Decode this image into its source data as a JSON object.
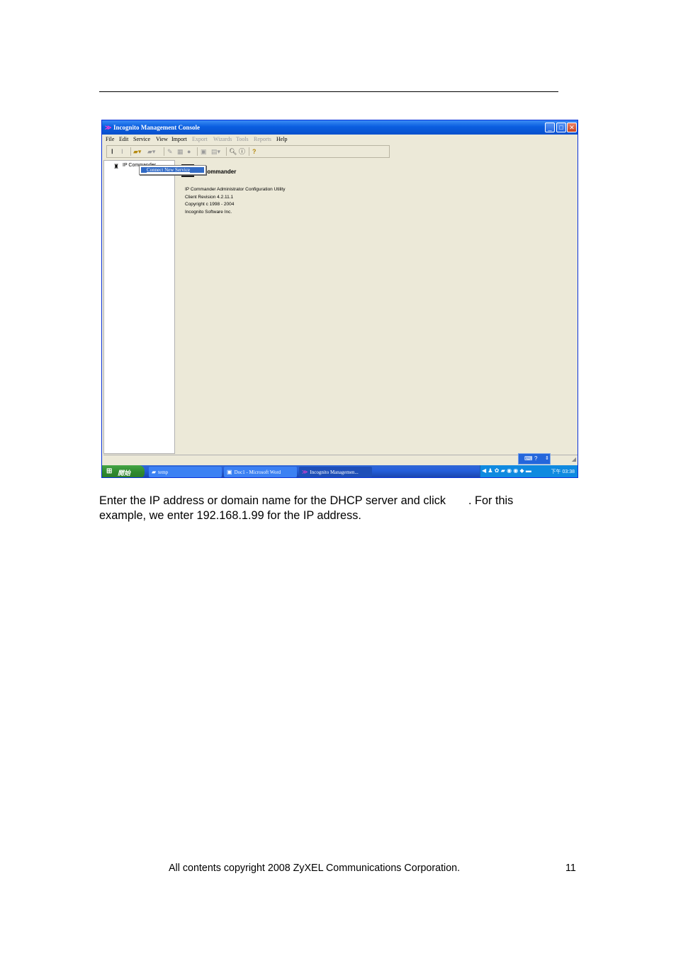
{
  "window": {
    "title": "Incognito Management Console",
    "menu": [
      {
        "label": "File",
        "enabled": true
      },
      {
        "label": "Edit",
        "enabled": true
      },
      {
        "label": "Service",
        "enabled": true
      },
      {
        "label": "View",
        "enabled": true
      },
      {
        "label": "Import",
        "enabled": true
      },
      {
        "label": "Export",
        "enabled": false
      },
      {
        "label": "Wizards",
        "enabled": false
      },
      {
        "label": "Tools",
        "enabled": false
      },
      {
        "label": "Reports",
        "enabled": false
      },
      {
        "label": "Help",
        "enabled": true
      }
    ],
    "tree": {
      "root_label": "IP Commander"
    },
    "context_menu": {
      "item": "Connect New Service"
    },
    "info": {
      "app_name": "IP Commander",
      "lines": [
        "IP Commander Administrator Configuration Utility",
        "Client Revision 4.2.11.1",
        "Copyright c 1998 - 2004",
        "Incognito Software Inc."
      ]
    },
    "taskbar": {
      "start_label": "開始",
      "tasks": [
        "temp",
        "Doc1 - Microsoft Word",
        "Incognito Managemen..."
      ],
      "clock": "下午 03:38"
    }
  },
  "body_text": {
    "line1_a": "Enter the IP address or domain name for the DHCP server and click",
    "line1_b": ". For this",
    "line2": "example, we enter 192.168.1.99 for the IP address."
  },
  "footer": {
    "copyright": "All contents copyright 2008 ZyXEL Communications Corporation.",
    "page_number": "11"
  }
}
